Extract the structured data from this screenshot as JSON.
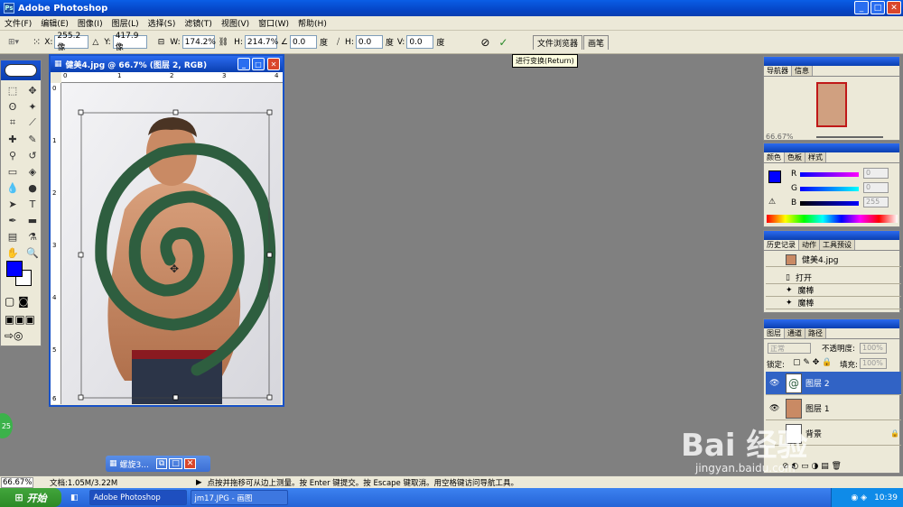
{
  "app": {
    "title": "Adobe Photoshop"
  },
  "menu": [
    "文件(F)",
    "编辑(E)",
    "图像(I)",
    "图层(L)",
    "选择(S)",
    "滤镜(T)",
    "视图(V)",
    "窗口(W)",
    "帮助(H)"
  ],
  "options": {
    "x_label": "X:",
    "x_value": "255.2 像",
    "y_label": "Y:",
    "y_value": "417.9 像",
    "w_label": "W:",
    "w_value": "174.2%",
    "h_label": "H:",
    "h_value": "214.7%",
    "angle_value": "0.0",
    "angle_unit": "度",
    "hskew_label": "H:",
    "hskew_value": "0.0",
    "hskew_unit": "度",
    "vskew_label": "V:",
    "vskew_value": "0.0",
    "vskew_unit": "度",
    "tab_browser": "文件浏览器",
    "tab_brush": "画笔",
    "tooltip": "进行变换(Return)"
  },
  "document": {
    "title": "健美4.jpg @ 66.7% (图层 2, RGB)",
    "ruler_h": [
      "0",
      "1",
      "2",
      "3",
      "4"
    ],
    "ruler_v": [
      "0",
      "1",
      "2",
      "3",
      "4",
      "5",
      "6"
    ]
  },
  "navigator": {
    "tabs": [
      "导航器",
      "信息"
    ],
    "zoom": "66.67%"
  },
  "color": {
    "tabs": [
      "颜色",
      "色板",
      "样式"
    ],
    "r_label": "R",
    "g_label": "G",
    "b_label": "B",
    "r_value": "0",
    "g_value": "0",
    "b_value": "255"
  },
  "history": {
    "tabs": [
      "历史记录",
      "动作",
      "工具预设"
    ],
    "items": [
      "健美4.jpg",
      "打开",
      "魔棒",
      "魔棒"
    ]
  },
  "layers": {
    "tabs": [
      "图层",
      "通道",
      "路径"
    ],
    "blend": "正常",
    "opacity_label": "不透明度:",
    "opacity": "100%",
    "lock_label": "锁定:",
    "fill_label": "填充:",
    "fill": "100%",
    "items": [
      "图层 2",
      "图层 1",
      "背景"
    ]
  },
  "minidoc": {
    "title": "螺旋3..."
  },
  "status": {
    "zoom": "66.67%",
    "doc": "文档:1.05M/3.22M",
    "hint": "点按并拖移可从边上测量。按 Enter 键提交。按 Escape 键取消。用空格键访问导航工具。"
  },
  "taskbar": {
    "start": "开始",
    "tasks": [
      "Adobe Photoshop",
      "jm17.JPG - 画图"
    ],
    "clock": "10:39"
  },
  "watermark": {
    "logo": "Bai 经验",
    "url": "jingyan.baidu.com"
  },
  "colors": {
    "foreground": "#0000ff",
    "background": "#ffffff",
    "spiral": "#2e5e3f",
    "xp_blue": "#0a3fb0"
  }
}
